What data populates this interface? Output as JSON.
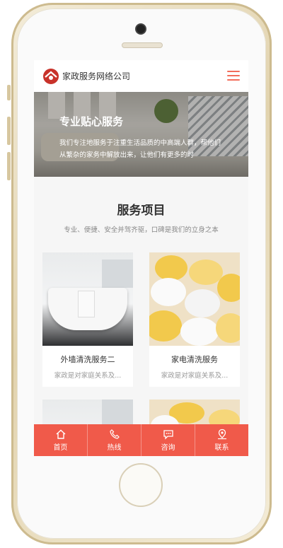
{
  "header": {
    "brand": "家政服务网络公司"
  },
  "hero": {
    "title": "专业贴心服务",
    "text": "我们专注地服务于注重生活品质的中高端人群，帮他们从繁杂的家务中解放出来，让他们有更多的时"
  },
  "section": {
    "title": "服务项目",
    "subtitle": "专业、便捷、安全并驾齐驱，口碑是我们的立身之本"
  },
  "services": [
    {
      "name": "外墙清洗服务二",
      "desc": "家政是对家庭关系及...",
      "image": "bathtub"
    },
    {
      "name": "家电清洗服务",
      "desc": "家政是对家庭关系及...",
      "image": "towels"
    }
  ],
  "bottom_nav": [
    {
      "label": "首页",
      "icon": "home-icon"
    },
    {
      "label": "热线",
      "icon": "phone-icon"
    },
    {
      "label": "咨询",
      "icon": "chat-icon"
    },
    {
      "label": "联系",
      "icon": "location-icon"
    }
  ],
  "colors": {
    "accent": "#f05a4a",
    "menu": "#f26d5b"
  }
}
